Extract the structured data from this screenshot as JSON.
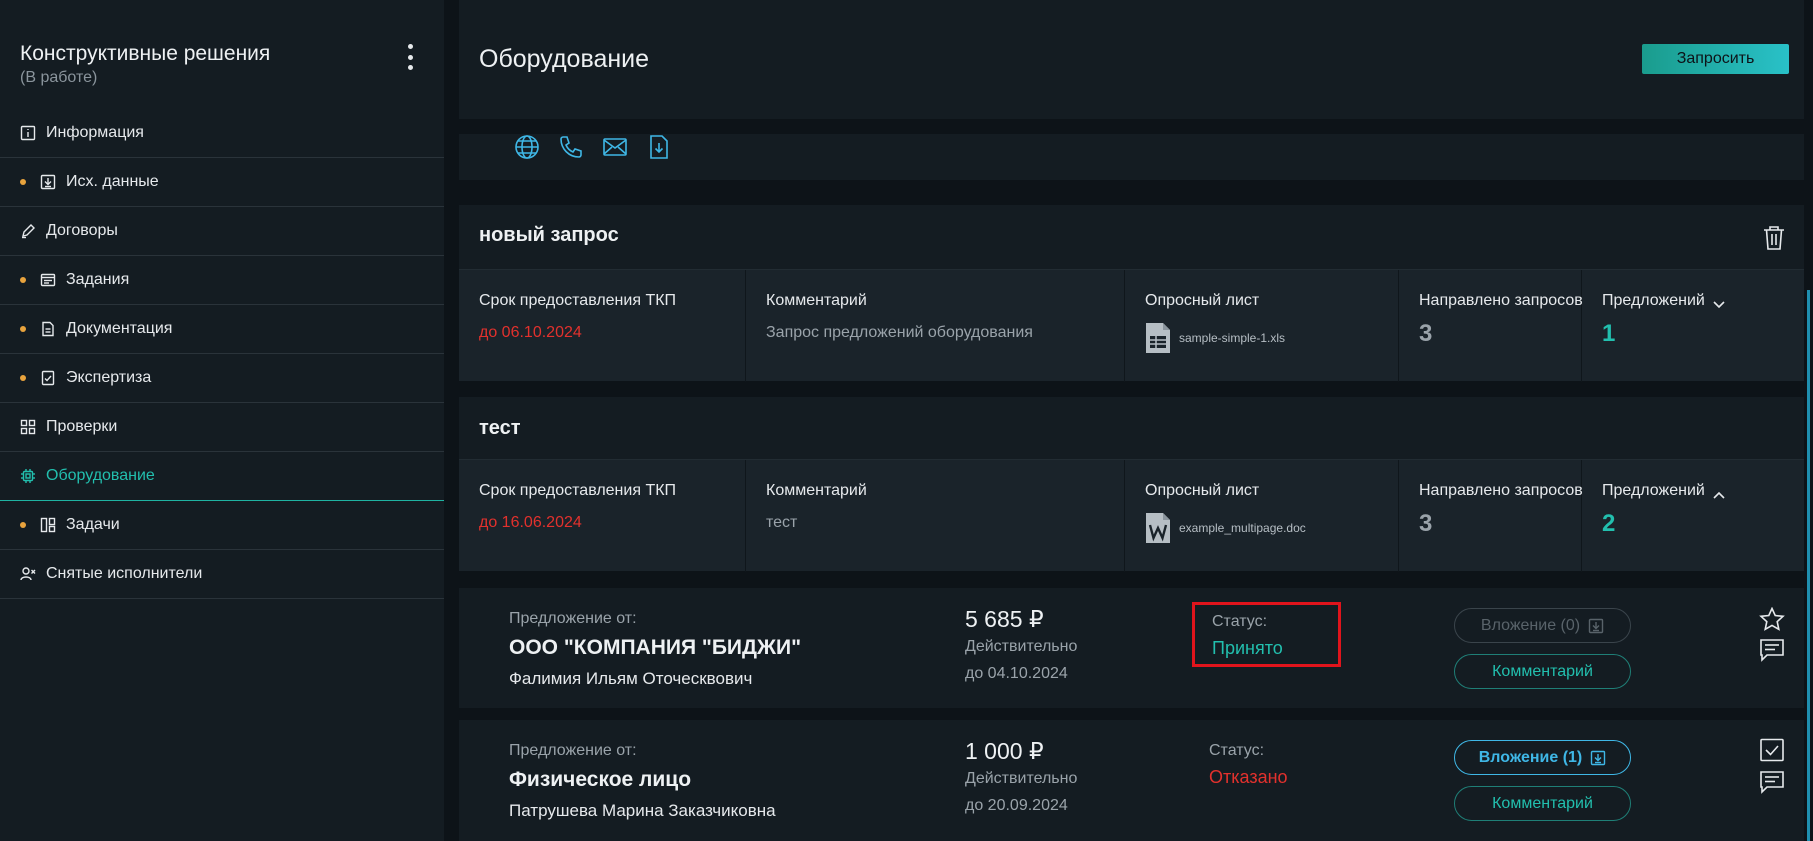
{
  "sidebar": {
    "project_title": "Конструктивные решения",
    "project_status": "(В работе)",
    "items": [
      {
        "label": "Информация",
        "icon": "info-icon",
        "dot": false,
        "active": false
      },
      {
        "label": "Исх. данные",
        "icon": "download-box-icon",
        "dot": true,
        "active": false
      },
      {
        "label": "Договоры",
        "icon": "pen-icon",
        "dot": false,
        "active": false
      },
      {
        "label": "Задания",
        "icon": "window-icon",
        "dot": true,
        "active": false
      },
      {
        "label": "Документация",
        "icon": "document-icon",
        "dot": true,
        "active": false
      },
      {
        "label": "Экспертиза",
        "icon": "check-doc-icon",
        "dot": true,
        "active": false
      },
      {
        "label": "Проверки",
        "icon": "grid-check-icon",
        "dot": false,
        "active": false
      },
      {
        "label": "Оборудование",
        "icon": "chip-icon",
        "dot": false,
        "active": true
      },
      {
        "label": "Задачи",
        "icon": "kanban-icon",
        "dot": true,
        "active": false
      },
      {
        "label": "Снятые исполнители",
        "icon": "user-remove-icon",
        "dot": false,
        "active": false
      }
    ]
  },
  "header": {
    "title": "Оборудование",
    "request_button": "Запросить"
  },
  "contact_icons": [
    "globe-icon",
    "phone-icon",
    "mail-icon",
    "file-download-icon"
  ],
  "columns": {
    "deadline": "Срок предоставления ТКП",
    "comment": "Комментарий",
    "questionnaire": "Опросный лист",
    "sent": "Направлено запросов",
    "offers": "Предложений"
  },
  "requests": [
    {
      "title": "новый запрос",
      "deadline": "до 06.10.2024",
      "comment": "Запрос предложений оборудования",
      "file_name": "sample-simple-1.xls",
      "file_icon": "spreadsheet-file-icon",
      "sent": "3",
      "offers": "1",
      "expanded": false
    },
    {
      "title": "тест",
      "deadline": "до 16.06.2024",
      "comment": "тест",
      "file_name": "example_multipage.doc",
      "file_icon": "word-file-icon",
      "sent": "3",
      "offers": "2",
      "expanded": true
    }
  ],
  "offers": [
    {
      "from_label": "Предложение от:",
      "company": "ООО \"КОМПАНИЯ \"БИДЖИ\"",
      "person": "Фалимия Ильям Оточесквович",
      "price": "5 685 ₽",
      "valid_label": "Действительно",
      "valid_until": "до 04.10.2024",
      "status_label": "Статус:",
      "status": "Принято",
      "attach_label": "Вложение (0)",
      "comment_label": "Комментарий",
      "side_icon": "star-icon"
    },
    {
      "from_label": "Предложение от:",
      "company": "Физическое лицо",
      "person": "Патрушева Марина Заказчиковна",
      "price": "1 000 ₽",
      "valid_label": "Действительно",
      "valid_until": "до 20.09.2024",
      "status_label": "Статус:",
      "status": "Отказано",
      "attach_label": "Вложение (1)",
      "comment_label": "Комментарий",
      "side_icon": "checkbox-icon"
    }
  ],
  "colors": {
    "accent_teal": "#22bfae",
    "accent_blue": "#3fb7e6",
    "danger_red": "#e2312d",
    "dot_orange": "#e8a33d",
    "highlight_red": "#e0141c"
  }
}
